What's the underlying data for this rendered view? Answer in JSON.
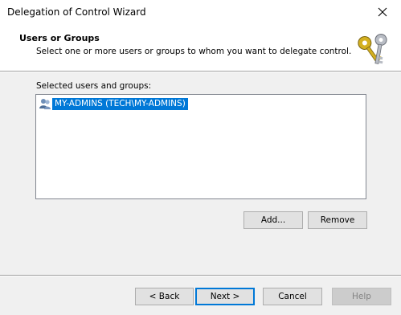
{
  "window": {
    "title": "Delegation of Control Wizard"
  },
  "header": {
    "heading": "Users or Groups",
    "description": "Select one or more users or groups to whom you want to delegate control."
  },
  "list": {
    "label": "Selected users and groups:",
    "items": [
      {
        "label": "MY-ADMINS (TECH\\MY-ADMINS)",
        "selected": true,
        "icon": "group-icon"
      }
    ]
  },
  "actions": {
    "add_label": "Add...",
    "remove_label": "Remove"
  },
  "footer": {
    "back_label": "< Back",
    "next_label": "Next >",
    "cancel_label": "Cancel",
    "help_label": "Help"
  },
  "colors": {
    "selection": "#0078d7",
    "dialog_bg": "#f0f0f0",
    "default_button_border": "#0078d7"
  }
}
